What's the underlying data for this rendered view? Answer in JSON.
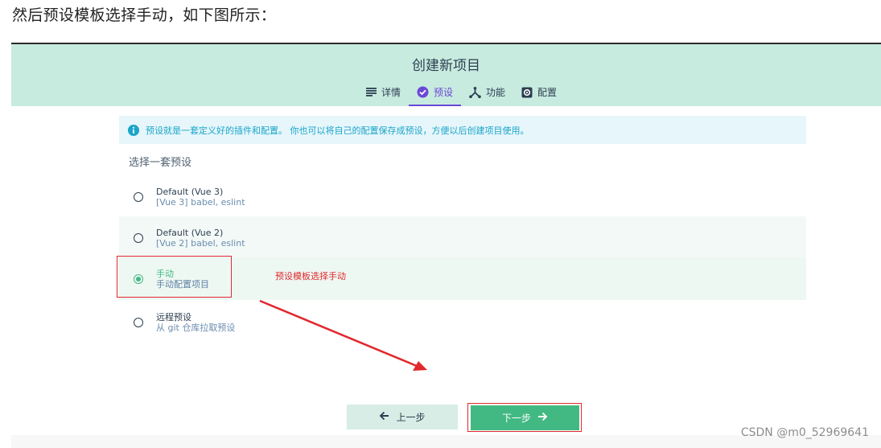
{
  "intro_text": "然后预设模板选择手动，如下图所示：",
  "header": {
    "title": "创建新项目",
    "tabs": [
      {
        "label": "详情",
        "icon": "list-icon",
        "active": false
      },
      {
        "label": "预设",
        "icon": "check-circle-icon",
        "active": true
      },
      {
        "label": "功能",
        "icon": "branch-icon",
        "active": false
      },
      {
        "label": "配置",
        "icon": "gear-icon",
        "active": false
      }
    ]
  },
  "info_message": "预设就是一套定义好的插件和配置。 你也可以将自己的配置保存成预设，方便以后创建项目使用。",
  "section_title": "选择一套预设",
  "presets": [
    {
      "name": "Default (Vue 3)",
      "description": "[Vue 3] babel, eslint",
      "selected": false
    },
    {
      "name": "Default (Vue 2)",
      "description": "[Vue 2] babel, eslint",
      "selected": false
    },
    {
      "name": "手动",
      "description": "手动配置项目",
      "selected": true
    },
    {
      "name": "远程预设",
      "description": "从 git 仓库拉取预设",
      "selected": false
    }
  ],
  "annotation": "预设模板选择手动",
  "buttons": {
    "prev_label": "上一步",
    "next_label": "下一步"
  },
  "watermark": "CSDN @m0_52969641",
  "colors": {
    "header_bg": "#c8ebe0",
    "accent_purple": "#6b47d6",
    "accent_green": "#42b983",
    "info_bg": "#e6f6fb",
    "info_text": "#1aa5c9",
    "annotation_red": "#e0282d"
  }
}
